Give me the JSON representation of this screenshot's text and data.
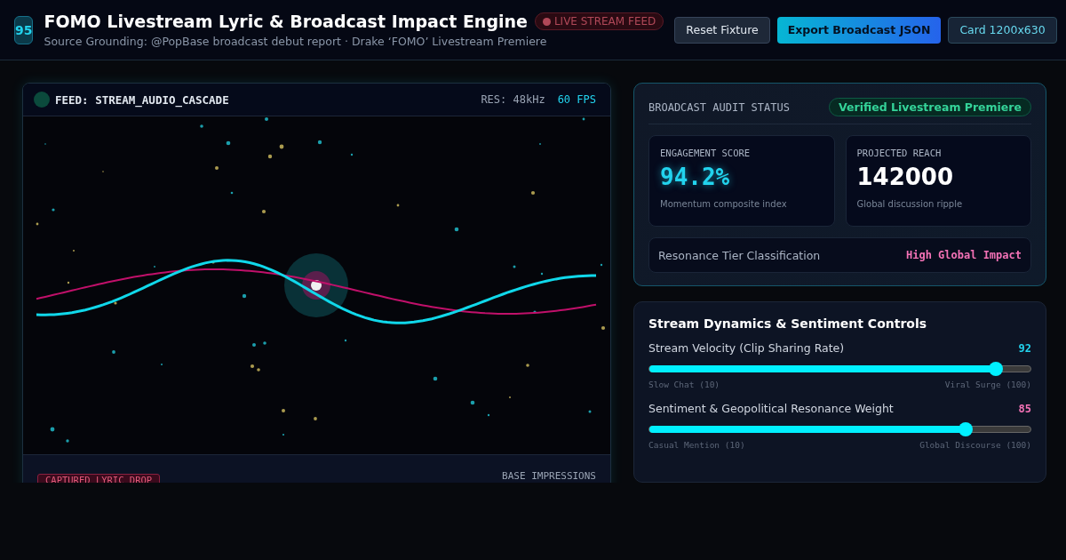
{
  "header": {
    "score_badge": "95",
    "title": "FOMO Livestream Lyric & Broadcast Impact Engine",
    "live_badge": "LIVE STREAM FEED",
    "subtitle": "Source Grounding: @PopBase broadcast debut report · Drake ‘FOMO’ Livestream Premiere",
    "buttons": [
      {
        "label": "Reset Fixture",
        "kind": "secondary"
      },
      {
        "label": "Export Broadcast JSON",
        "kind": "primary"
      },
      {
        "label": "Card 1200x630",
        "kind": "outline"
      }
    ]
  },
  "feed": {
    "title": "FEED: STREAM_AUDIO_CASCADE",
    "resolution": "RES: 48kHz",
    "fps": "60 FPS",
    "footer_tag": "CAPTURED LYRIC DROP",
    "footer_label": "BASE IMPRESSIONS"
  },
  "audit": {
    "title": "BROADCAST AUDIT STATUS",
    "status": "Verified Livestream Premiere",
    "metrics": [
      {
        "label": "ENGAGEMENT SCORE",
        "value": "94.2%",
        "caption": "Momentum composite index",
        "kind": "accent"
      },
      {
        "label": "PROJECTED REACH",
        "value": "142000",
        "caption": "Global discussion ripple",
        "kind": "plain"
      }
    ],
    "tier_label": "Resonance Tier Classification",
    "tier_value": "High Global Impact"
  },
  "controls": {
    "title": "Stream Dynamics & Sentiment Controls",
    "sliders": [
      {
        "label": "Stream Velocity (Clip Sharing Rate)",
        "reading": "92",
        "level": 0.91,
        "color": "#22d3ee",
        "min_label": "Slow Chat (10)",
        "max_label": "Viral Surge (100)"
      },
      {
        "label": "Sentiment & Geopolitical Resonance Weight",
        "reading": "85",
        "level": 0.83,
        "color": "#f472b6",
        "min_label": "Casual Mention (10)",
        "max_label": "Global Discourse (100)"
      }
    ]
  }
}
